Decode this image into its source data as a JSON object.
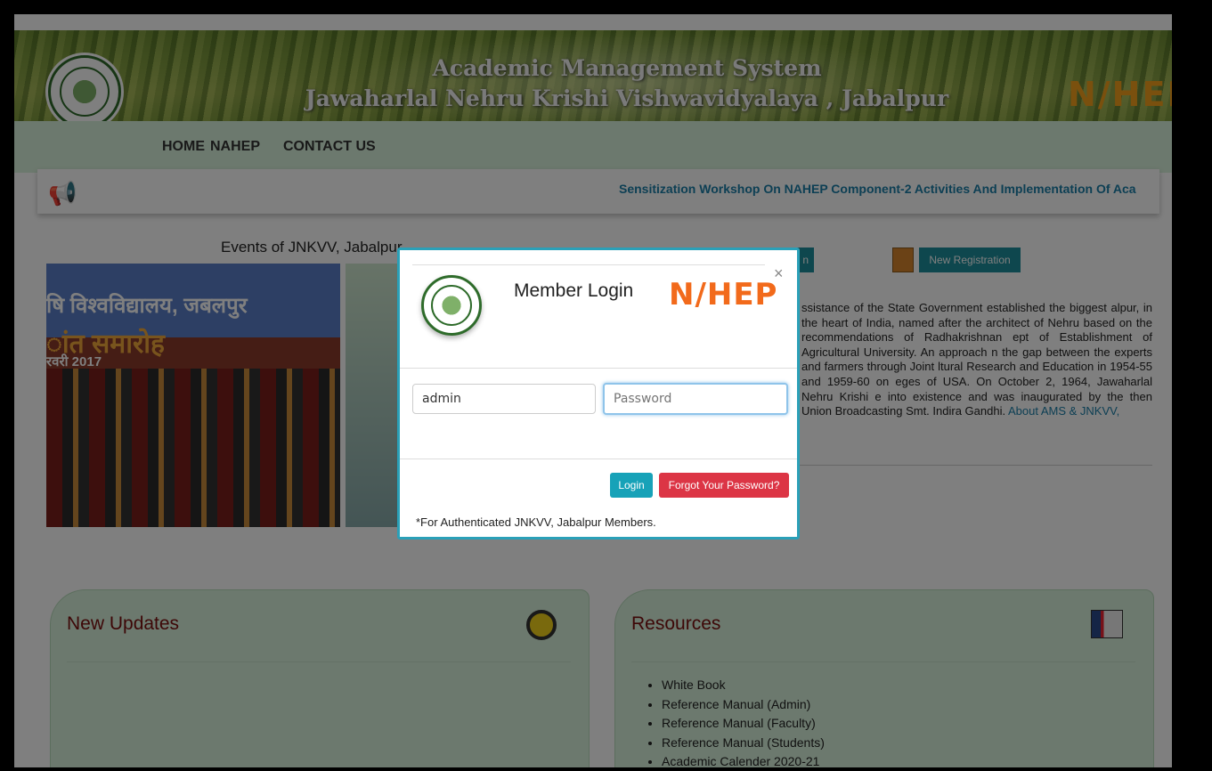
{
  "header": {
    "title_line1": "Academic Management System",
    "title_line2": "Jawaharlal Nehru Krishi Vishwavidyalaya , Jabalpur",
    "brand": "N/HEP"
  },
  "nav": {
    "items": [
      "HOME",
      "NAHEP",
      "CONTACT US"
    ]
  },
  "ticker": {
    "icon": "megaphone-icon",
    "text": "Sensitization Workshop On NAHEP Component-2 Activities And Implementation Of Aca"
  },
  "events": {
    "title": "Events of JNKVV, Jabalpur",
    "slide_text_line1": "षि विश्वविद्यालय, जबलपुर",
    "slide_text_line2": "ांत समारोह",
    "slide_text_line3": "रवरी 2017"
  },
  "actions": {
    "login_label": "n",
    "new_registration_label": "New Registration"
  },
  "about": {
    "text": "ssistance of the State Government established the biggest alpur, in the heart of India, named after the architect of Nehru based on the recommendations of Radhakrishnan ept of Establishment of Agricultural University. An approach n the gap between the experts and farmers through Joint ltural Research and Education in 1954-55 and 1959-60 on eges of USA. On October 2, 1964, Jawaharlal Nehru Krishi e into existence and was inaugurated by the then Union Broadcasting Smt. Indira Gandhi.",
    "link": "About AMS & JNKVV,"
  },
  "panels": {
    "updates_title": "New Updates",
    "resources_title": "Resources",
    "resources": [
      "White Book",
      "Reference Manual (Admin)",
      "Reference Manual (Faculty)",
      "Reference Manual (Students)",
      "Academic Calender 2020-21"
    ]
  },
  "modal": {
    "title": "Member Login",
    "brand": "N/HEP",
    "close": "×",
    "username_value": "admin",
    "password_placeholder": "Password",
    "login_button": "Login",
    "forgot_button": "Forgot Your Password?",
    "note": "*For Authenticated JNKVV, Jabalpur Members."
  },
  "colors": {
    "nav_bg": "#d9f2dc",
    "accent": "#17a2b8",
    "danger": "#dc3545",
    "heading": "#7a0f0f",
    "brand_orange": "#f26a1b"
  }
}
